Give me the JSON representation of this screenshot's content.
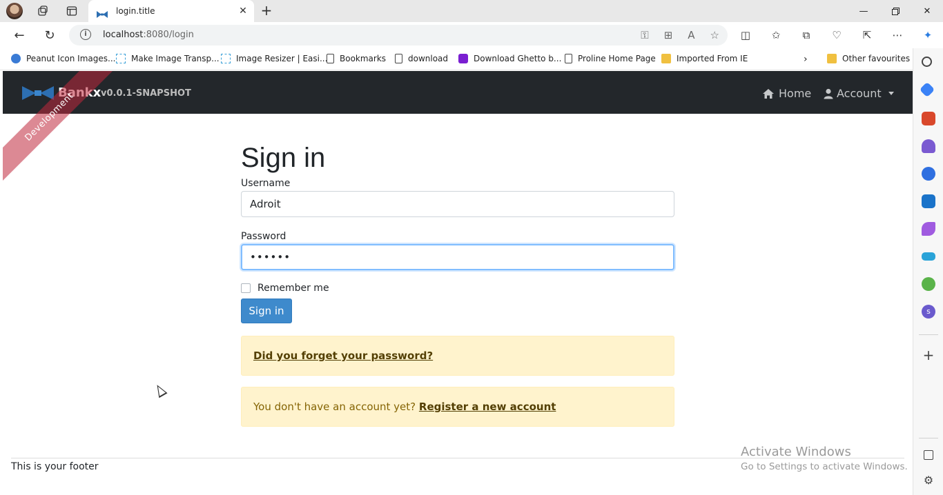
{
  "browser": {
    "tab_title": "login.title",
    "url_host": "localhost",
    "url_rest": ":8080/login",
    "bookmarks": [
      {
        "label": "Peanut Icon Images...",
        "icon": "blue-app-icon"
      },
      {
        "label": "Make Image Transp...",
        "icon": "image-icon"
      },
      {
        "label": "Image Resizer | Easi...",
        "icon": "image-icon"
      },
      {
        "label": "Bookmarks",
        "icon": "page-icon"
      },
      {
        "label": "download",
        "icon": "page-icon"
      },
      {
        "label": "Download Ghetto b...",
        "icon": "purple-app-icon"
      },
      {
        "label": "Proline Home Page",
        "icon": "page-icon"
      },
      {
        "label": "Imported From IE",
        "icon": "folder-icon"
      }
    ],
    "other_favourites": "Other favourites"
  },
  "app": {
    "brand_name": "Bankx",
    "version": "v0.0.1-SNAPSHOT",
    "ribbon": "Development",
    "nav": {
      "home": "Home",
      "account": "Account"
    }
  },
  "login": {
    "title": "Sign in",
    "username_label": "Username",
    "username_value": "Adroit",
    "password_label": "Password",
    "password_value": "••••••",
    "remember_label": "Remember me",
    "submit_label": "Sign in",
    "forgot_link": "Did you forget your password?",
    "no_account_text": "You don't have an account yet?",
    "register_link": "Register a new account"
  },
  "footer": {
    "text": "This is your footer"
  },
  "watermark": {
    "line1": "Activate Windows",
    "line2": "Go to Settings to activate Windows."
  },
  "colors": {
    "navbar": "#23272b",
    "primary_button": "#3e8acc",
    "alert_bg": "#fff3cd",
    "ribbon": "#c0283c"
  }
}
